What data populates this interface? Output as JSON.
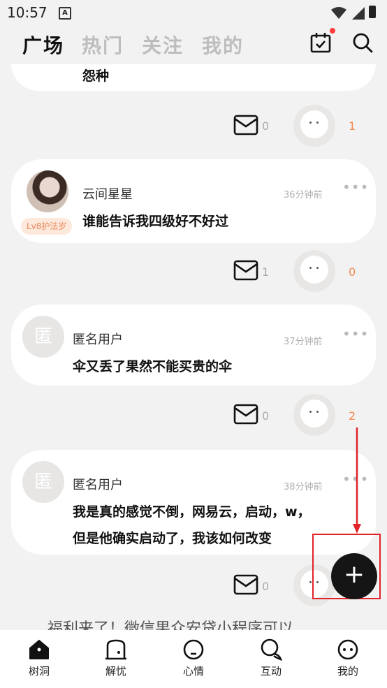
{
  "status_bar": {
    "time": "10:57",
    "notification_badge": "A"
  },
  "top_nav": {
    "tabs": [
      {
        "label": "广场",
        "active": true
      },
      {
        "label": "热门",
        "active": false
      },
      {
        "label": "关注",
        "active": false
      },
      {
        "label": "我的",
        "active": false
      }
    ],
    "icons": [
      "calendar-check-icon",
      "search-icon"
    ]
  },
  "posts": [
    {
      "content_tail": "怨种",
      "comments": "0",
      "hugs": "1"
    },
    {
      "username": "云间星星",
      "time": "36分钟前",
      "level": "Lv8护法岁",
      "content_lines": [
        "谁能告诉我四级好不好过"
      ],
      "comments": "1",
      "hugs": "0"
    },
    {
      "username": "匿名用户",
      "avatar_text": "匿",
      "time": "37分钟前",
      "content_lines": [
        "伞又丢了果然不能买贵的伞"
      ],
      "comments": "0",
      "hugs": "2"
    },
    {
      "username": "匿名用户",
      "avatar_text": "匿",
      "time": "38分钟前",
      "content_lines": [
        "我是真的感觉不倒，网易云，启动，w，",
        "但是他确实启动了，我该如何改变"
      ],
      "comments": "0"
    }
  ],
  "more_label": "•••",
  "promo_text": "福利来了！微信果众安贷小程序可以",
  "fab_label": "+",
  "bottom_nav": [
    {
      "label": "树洞",
      "icon": "home-icon"
    },
    {
      "label": "解忧",
      "icon": "door-icon"
    },
    {
      "label": "心情",
      "icon": "mood-icon"
    },
    {
      "label": "互动",
      "icon": "chat-icon"
    },
    {
      "label": "我的",
      "icon": "profile-icon"
    }
  ],
  "colors": {
    "accent_orange": "#f08a50",
    "fab": "#151515",
    "annotation_red": "#e0242a"
  }
}
